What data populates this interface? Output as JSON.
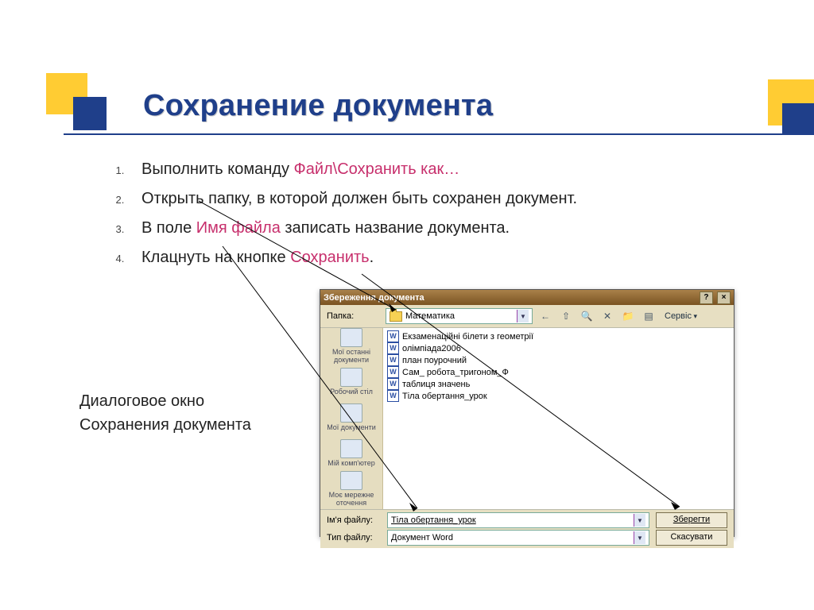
{
  "title": "Сохранение документа",
  "steps": {
    "s1a": "Выполнить команду ",
    "s1b": "Файл\\Сохранить как…",
    "s2": "Открыть папку, в которой должен быть сохранен документ.",
    "s3a": "В поле ",
    "s3b": "Имя файла",
    "s3c": " записать название документа.",
    "s4a": "Клацнуть на кнопке ",
    "s4b": "Сохранить",
    "s4c": "."
  },
  "caption": {
    "line1": "Диалоговое окно",
    "line2": "Сохранения документа"
  },
  "dialog": {
    "title": "Збереження документа",
    "help": "?",
    "close": "×",
    "folder_label": "Папка:",
    "folder_value": "Математика",
    "service": "Сервіс",
    "places": {
      "recent": "Мої останні документи",
      "desktop": "Робочий стіл",
      "mydocs": "Мої документи",
      "mypc": "Мій комп'ютер",
      "network": "Моє мережне оточення"
    },
    "files": [
      "Екзаменаційні білети з геометрії",
      "олімпіада2006",
      "план поурочний",
      "Сам_ робота_тригоном_Ф",
      "таблиця значень",
      "Тіла обертання_урок"
    ],
    "filename_label": "Ім'я файлу:",
    "filename_value": "Тіла обертання_урок",
    "filetype_label": "Тип файлу:",
    "filetype_value": "Документ Word",
    "save_btn": "Зберегти",
    "cancel_btn": "Скасувати"
  }
}
